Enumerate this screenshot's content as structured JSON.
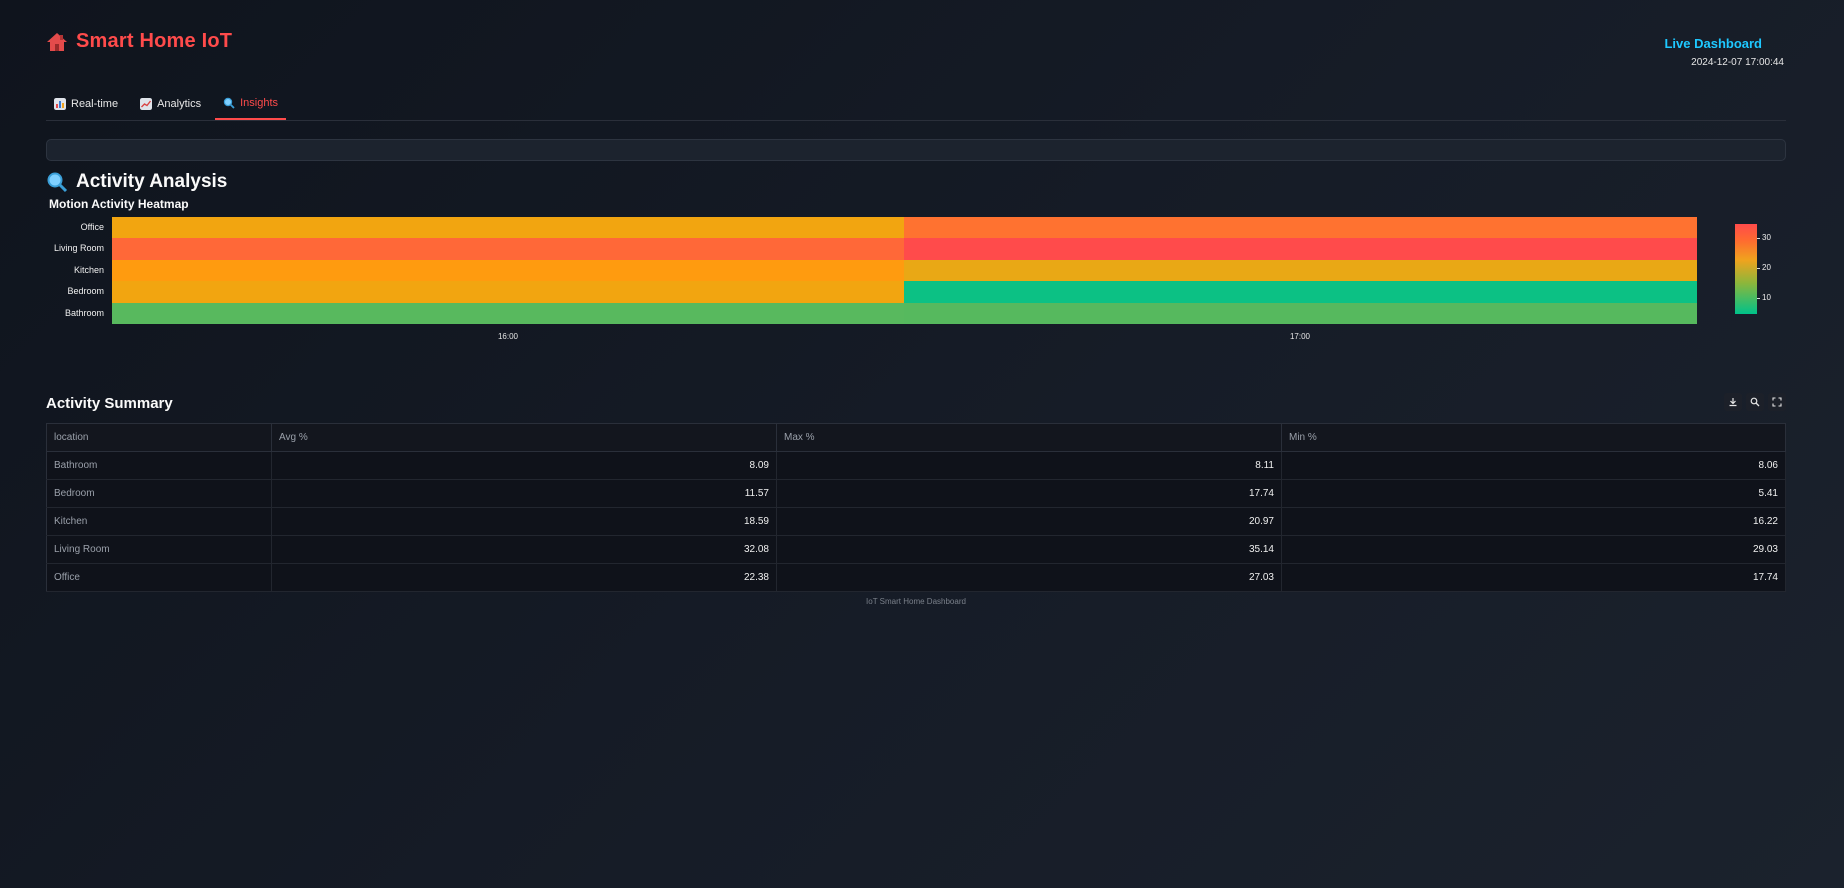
{
  "app": {
    "title": "Smart Home IoT",
    "brand_color": "#ff4b4b"
  },
  "header": {
    "status_label": "Live Dashboard",
    "timestamp": "2024-12-07 17:00:44"
  },
  "tabs": [
    {
      "label": "Real-time",
      "icon": "bar-chart-icon",
      "active": false
    },
    {
      "label": "Analytics",
      "icon": "line-chart-icon",
      "active": false
    },
    {
      "label": "Insights",
      "icon": "magnifier-icon",
      "active": true
    }
  ],
  "insights": {
    "title": "Activity Analysis",
    "heatmap_title": "Motion Activity Heatmap"
  },
  "chart_data": {
    "type": "heatmap",
    "title": "Motion Activity Heatmap",
    "x": [
      "16:00",
      "17:00"
    ],
    "y": [
      "Office",
      "Living Room",
      "Kitchen",
      "Bedroom",
      "Bathroom"
    ],
    "values": [
      [
        17.74,
        27.03
      ],
      [
        29.03,
        35.14
      ],
      [
        20.97,
        16.22
      ],
      [
        17.74,
        5.41
      ],
      [
        8.11,
        8.06
      ]
    ],
    "colorbar": {
      "ticks": [
        10,
        20,
        30
      ],
      "range": [
        5,
        35
      ]
    },
    "colorscale": [
      "#00c28a",
      "#d4ad1f",
      "#ffa20a",
      "#ff6f33",
      "#ff4b4b"
    ]
  },
  "summary": {
    "title": "Activity Summary",
    "tools": [
      "download-icon",
      "search-icon",
      "fullscreen-icon"
    ],
    "columns": [
      "location",
      "Avg %",
      "Max %",
      "Min %"
    ],
    "rows": [
      [
        "Bathroom",
        "8.09",
        "8.11",
        "8.06"
      ],
      [
        "Bedroom",
        "11.57",
        "17.74",
        "5.41"
      ],
      [
        "Kitchen",
        "18.59",
        "20.97",
        "16.22"
      ],
      [
        "Living Room",
        "32.08",
        "35.14",
        "29.03"
      ],
      [
        "Office",
        "22.38",
        "27.03",
        "17.74"
      ]
    ]
  },
  "footer": {
    "text": "IoT Smart Home Dashboard"
  }
}
